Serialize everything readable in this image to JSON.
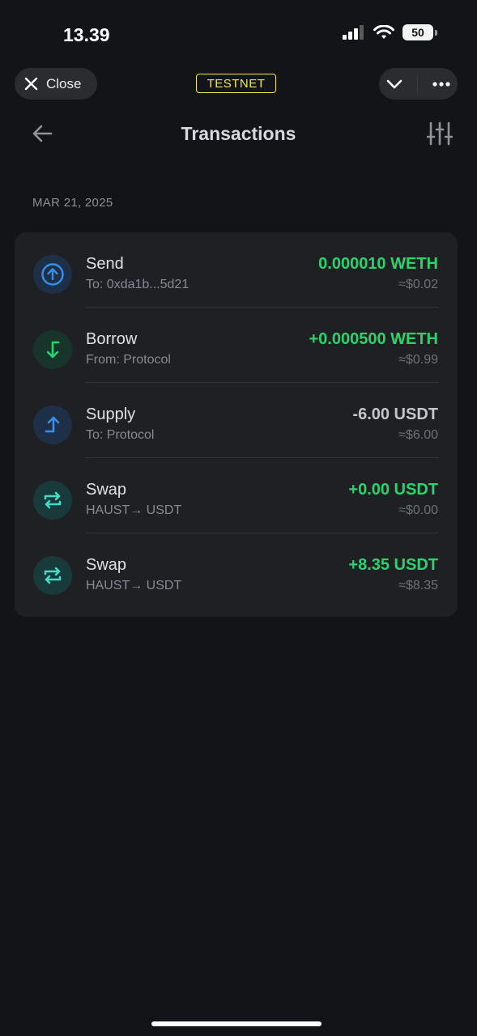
{
  "status_bar": {
    "time": "13.39",
    "battery": "50"
  },
  "top_bar": {
    "close_label": "Close",
    "network_badge": "TESTNET"
  },
  "header": {
    "title": "Transactions"
  },
  "date_group": "MAR 21, 2025",
  "colors": {
    "green": "#2bd36e",
    "blue": "#3b8ee8",
    "teal": "#48d8c8",
    "neutral": "#c3c6cc"
  },
  "transactions": [
    {
      "title": "Send",
      "subtitle": "To: 0xda1b...5d21",
      "amount": "0.000010 WETH",
      "fiat": "≈$0.02",
      "icon": "arrow-up-circle-icon",
      "amount_color": "green"
    },
    {
      "title": "Borrow",
      "subtitle": "From: Protocol",
      "amount": "+0.000500 WETH",
      "fiat": "≈$0.99",
      "icon": "borrow-arrow-icon",
      "amount_color": "green"
    },
    {
      "title": "Supply",
      "subtitle": "To: Protocol",
      "amount": "-6.00 USDT",
      "fiat": "≈$6.00",
      "icon": "supply-arrow-icon",
      "amount_color": "neutral"
    },
    {
      "title": "Swap",
      "subtitle": "HAUST→ USDT",
      "amount": "+0.00 USDT",
      "fiat": "≈$0.00",
      "icon": "swap-icon",
      "amount_color": "green"
    },
    {
      "title": "Swap",
      "subtitle": "HAUST→ USDT",
      "amount": "+8.35 USDT",
      "fiat": "≈$8.35",
      "icon": "swap-icon",
      "amount_color": "green"
    }
  ]
}
